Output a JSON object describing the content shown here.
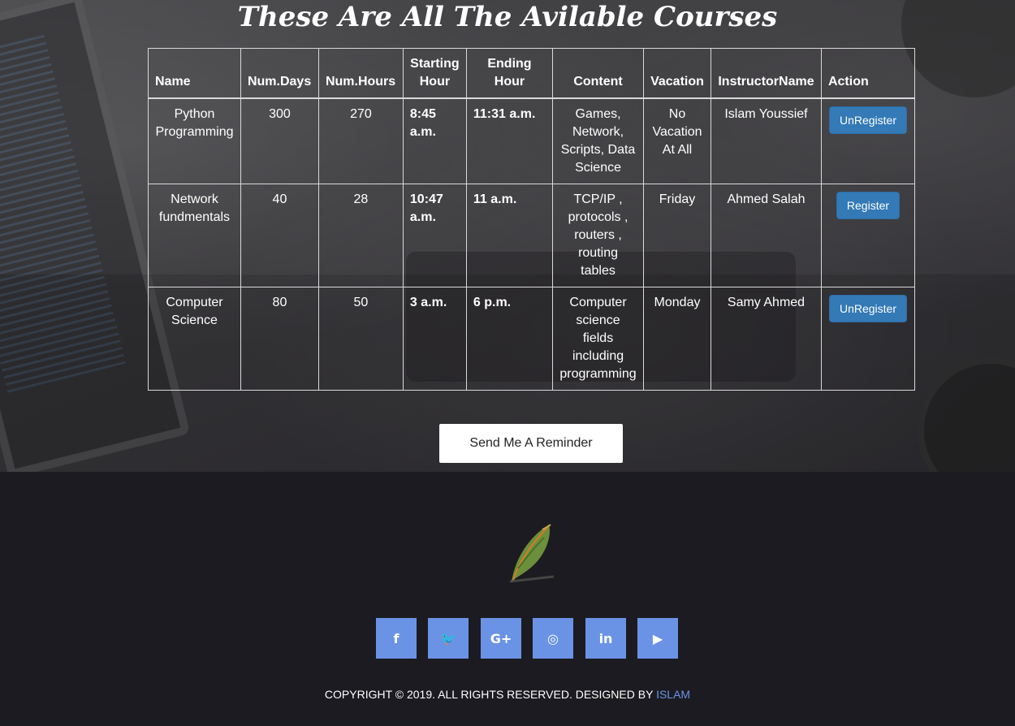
{
  "page": {
    "title": "These Are All The Avilable Courses"
  },
  "table": {
    "headers": {
      "name": "Name",
      "days": "Num.Days",
      "hours": "Num.Hours",
      "start": "Starting Hour",
      "end": "Ending Hour",
      "content": "Content",
      "vacation": "Vacation",
      "instructor": "InstructorName",
      "action": "Action"
    },
    "rows": [
      {
        "name": "Python Programming",
        "days": "300",
        "hours": "270",
        "start": "8:45 a.m.",
        "end": "11:31 a.m.",
        "content": "Games, Network, Scripts, Data Science",
        "vacation": "No Vacation At All",
        "instructor": "Islam Youssief",
        "action": "UnRegister"
      },
      {
        "name": "Network fundmentals",
        "days": "40",
        "hours": "28",
        "start": "10:47 a.m.",
        "end": "11 a.m.",
        "content": "TCP/IP , protocols , routers , routing tables",
        "vacation": "Friday",
        "instructor": "Ahmed Salah",
        "action": "Register"
      },
      {
        "name": "Computer Science",
        "days": "80",
        "hours": "50",
        "start": "3 a.m.",
        "end": "6 p.m.",
        "content": "Computer science fields including programming",
        "vacation": "Monday",
        "instructor": "Samy Ahmed",
        "action": "UnRegister"
      }
    ]
  },
  "reminder_button": "Send Me A Reminder",
  "footer": {
    "logo_icon": "feather-quill-icon",
    "social": [
      {
        "icon": "facebook-icon",
        "glyph": "f"
      },
      {
        "icon": "twitter-icon",
        "glyph": "🐦"
      },
      {
        "icon": "google-plus-icon",
        "glyph": "G+"
      },
      {
        "icon": "instagram-icon",
        "glyph": "◎"
      },
      {
        "icon": "linkedin-icon",
        "glyph": "in"
      },
      {
        "icon": "youtube-icon",
        "glyph": "▶"
      }
    ],
    "copyright": "COPYRIGHT © 2019. ALL RIGHTS RESERVED. DESIGNED BY",
    "designer": "ISLAM",
    "accent_color": "#6a93e6"
  }
}
